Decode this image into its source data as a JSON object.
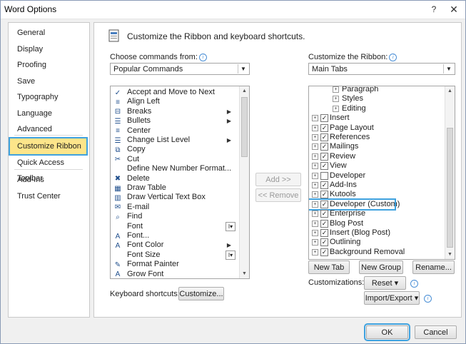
{
  "window": {
    "title": "Word Options",
    "help_icon": "?",
    "close_icon": "✕"
  },
  "nav": {
    "items": [
      {
        "label": "General"
      },
      {
        "label": "Display"
      },
      {
        "label": "Proofing"
      },
      {
        "label": "Save"
      },
      {
        "label": "Typography"
      },
      {
        "label": "Language"
      },
      {
        "label": "Advanced"
      },
      {
        "label": "Customize Ribbon",
        "selected": true
      },
      {
        "label": "Quick Access Toolbar"
      },
      {
        "label": "Add-Ins"
      },
      {
        "label": "Trust Center"
      }
    ]
  },
  "header": {
    "text": "Customize the Ribbon and keyboard shortcuts."
  },
  "left_panel": {
    "label": "Choose commands from:",
    "selected": "Popular Commands",
    "commands": [
      {
        "label": "Accept and Move to Next",
        "icon": "✓"
      },
      {
        "label": "Align Left",
        "icon": "≡"
      },
      {
        "label": "Breaks",
        "icon": "⊟",
        "submenu": true
      },
      {
        "label": "Bullets",
        "icon": "☰",
        "submenu": true
      },
      {
        "label": "Center",
        "icon": "≡"
      },
      {
        "label": "Change List Level",
        "icon": "☰",
        "submenu": true
      },
      {
        "label": "Copy",
        "icon": "⧉"
      },
      {
        "label": "Cut",
        "icon": "✂"
      },
      {
        "label": "Define New Number Format...",
        "icon": ""
      },
      {
        "label": "Delete",
        "icon": "✖"
      },
      {
        "label": "Draw Table",
        "icon": "▦"
      },
      {
        "label": "Draw Vertical Text Box",
        "icon": "▥"
      },
      {
        "label": "E-mail",
        "icon": "✉"
      },
      {
        "label": "Find",
        "icon": "⌕"
      },
      {
        "label": "Font",
        "icon": "",
        "combo": true
      },
      {
        "label": "Font...",
        "icon": "A"
      },
      {
        "label": "Font Color",
        "icon": "A",
        "submenu": true
      },
      {
        "label": "Font Size",
        "icon": "",
        "combo": true
      },
      {
        "label": "Format Painter",
        "icon": "✎"
      },
      {
        "label": "Grow Font",
        "icon": "A"
      }
    ]
  },
  "middle": {
    "add_label": "Add >>",
    "remove_label": "<< Remove"
  },
  "right_panel": {
    "label": "Customize the Ribbon:",
    "selected": "Main Tabs",
    "tabs": [
      {
        "label": "Paragraph",
        "level": 2
      },
      {
        "label": "Styles",
        "level": 2
      },
      {
        "label": "Editing",
        "level": 2
      },
      {
        "label": "Insert",
        "level": 1,
        "checked": true
      },
      {
        "label": "Page Layout",
        "level": 1,
        "checked": true
      },
      {
        "label": "References",
        "level": 1,
        "checked": true
      },
      {
        "label": "Mailings",
        "level": 1,
        "checked": true
      },
      {
        "label": "Review",
        "level": 1,
        "checked": true
      },
      {
        "label": "View",
        "level": 1,
        "checked": true
      },
      {
        "label": "Developer",
        "level": 1,
        "checked": false
      },
      {
        "label": "Add-Ins",
        "level": 1,
        "checked": true
      },
      {
        "label": "Kutools",
        "level": 1,
        "checked": true
      },
      {
        "label": "Developer (Custom)",
        "level": 1,
        "checked": true,
        "highlight": true
      },
      {
        "label": "Enterprise",
        "level": 1,
        "checked": true
      },
      {
        "label": "Blog Post",
        "level": 1,
        "checked": true
      },
      {
        "label": "Insert (Blog Post)",
        "level": 1,
        "checked": true
      },
      {
        "label": "Outlining",
        "level": 1,
        "checked": true
      },
      {
        "label": "Background Removal",
        "level": 1,
        "checked": true
      }
    ],
    "new_tab": "New Tab",
    "new_group": "New Group",
    "rename": "Rename...",
    "customizations_label": "Customizations:",
    "reset": "Reset ▾",
    "import_export": "Import/Export ▾"
  },
  "keyboard": {
    "label": "Keyboard shortcuts:",
    "button": "Customize..."
  },
  "footer": {
    "ok": "OK",
    "cancel": "Cancel"
  }
}
